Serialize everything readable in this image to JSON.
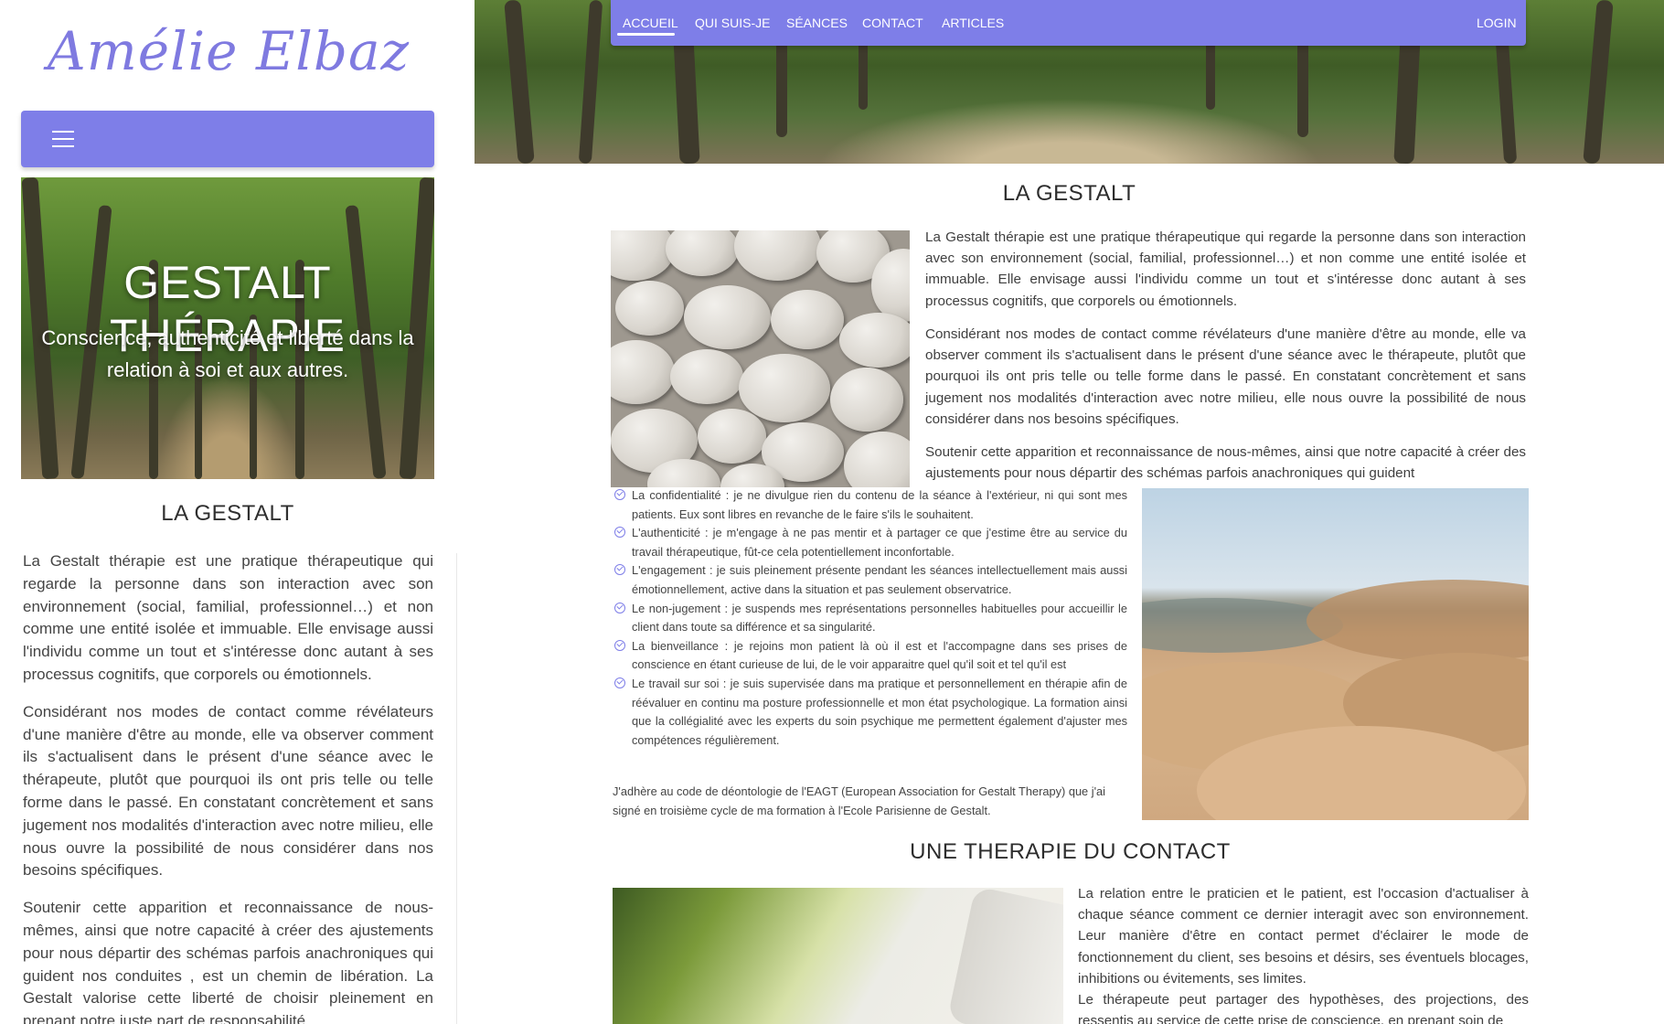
{
  "brand": {
    "name": "Amélie Elbaz"
  },
  "mobile_nav": {
    "menu_icon": "hamburger-icon"
  },
  "hero": {
    "title": "GESTALT THÉRAPIE",
    "subtitle": "Conscience, authenticité et liberté dans la relation à soi et aux autres."
  },
  "nav": {
    "items": [
      "ACCUEIL",
      "QUI SUIS-JE",
      "SÉANCES",
      "CONTACT",
      "ARTICLES"
    ],
    "active": "ACCUEIL",
    "login": "LOGIN"
  },
  "gestalt": {
    "heading": "LA GESTALT",
    "paragraphs": [
      "La Gestalt thérapie est une pratique thérapeutique qui regarde la personne dans son interaction avec son environnement (social, familial, professionnel…) et non comme une entité isolée et immuable. Elle envisage aussi l'individu comme un tout et s'intéresse donc autant à ses processus cognitifs, que corporels ou émotionnels.",
      "Considérant nos modes de contact comme révélateurs d'une manière d'être au monde, elle va observer comment ils s'actualisent dans le présent d'une séance avec le thérapeute, plutôt que pourquoi ils ont pris telle ou telle forme dans le passé. En constatant concrètement et sans jugement nos modalités d'interaction avec notre milieu, elle nous ouvre la possibilité de nous considérer dans nos besoins spécifiques.",
      "Soutenir cette apparition et reconnaissance de nous-mêmes, ainsi que notre capacité à créer des ajustements pour nous départir des schémas parfois anachroniques qui guident"
    ],
    "left_paragraph_3": "Soutenir cette apparition et reconnaissance de nous-mêmes, ainsi que notre capacité à créer des ajustements pour nous départir des schémas parfois anachroniques qui guident nos conduites , est un chemin de libération. La Gestalt valorise cette liberté de choisir pleinement en prenant notre juste part de responsabilité"
  },
  "values": [
    "La confidentialité : je ne divulgue rien du contenu de la séance à l'extérieur, ni qui sont mes patients. Eux sont libres en revanche de le faire s'ils le souhaitent.",
    "L'authenticité : je m'engage à ne pas mentir et à partager ce que j'estime être au service du travail thérapeutique, fût-ce cela potentiellement inconfortable.",
    "L'engagement : je suis pleinement présente pendant les séances intellectuellement mais aussi émotionnellement, active dans la situation et pas seulement observatrice.",
    "Le non-jugement : je suspends mes représentations personnelles habituelles pour accueillir le client dans toute sa différence et sa singularité.",
    "La bienveillance : je rejoins mon patient là où il est et l'accompagne dans ses prises de conscience en étant curieuse de lui, de le voir apparaitre quel qu'il soit et tel qu'il est",
    "Le travail sur soi : je suis supervisée dans ma pratique et personnellement en thérapie afin de réévaluer en continu ma posture professionnelle et mon état psychologique. La formation ainsi que la collégialité avec les experts du soin psychique me permettent également d'ajuster mes compétences régulièrement."
  ],
  "adhere": "J'adhère au code de déontologie de l'EAGT (European Association for Gestalt Therapy) que j'ai signé en troisième cycle de ma formation à l'Ecole Parisienne de Gestalt.",
  "contact_section": {
    "heading": "UNE THERAPIE DU CONTACT",
    "paragraphs": [
      "La relation entre le praticien et le patient, est l'occasion d'actualiser à chaque séance comment ce dernier interagit avec son environnement. Leur manière d'être en contact permet d'éclairer le mode de fonctionnement du client, ses besoins et désirs, ses éventuels blocages, inhibitions ou évitements, ses limites.",
      "Le thérapeute peut partager des hypothèses, des projections, des ressentis au service de cette prise de conscience, en prenant soin de"
    ]
  },
  "colors": {
    "accent": "#7e7ee8",
    "brand": "#7f7ae0"
  }
}
